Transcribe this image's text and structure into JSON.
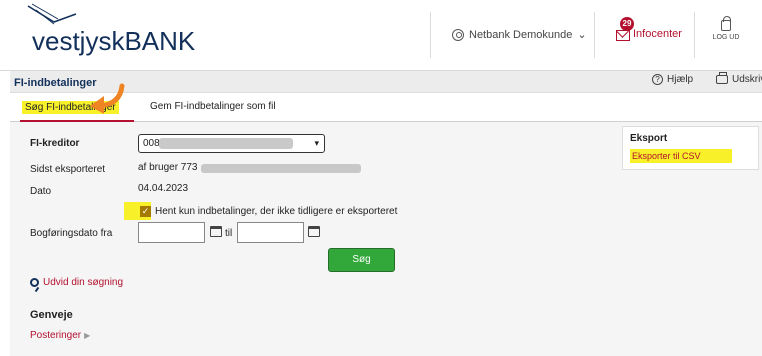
{
  "header": {
    "logo_text": "vestjyskBANK",
    "user_label": "Netbank Demokunde",
    "user_chevron": "⌄",
    "infocenter_label": "Infocenter",
    "infocenter_badge": "29",
    "logout_label": "LOG UD"
  },
  "titlebar": {
    "page_title": "FI-indbetalinger",
    "help_label": "Hjælp",
    "print_label": "Udskriv"
  },
  "tabs": [
    {
      "label": "Søg FI-indbetalinger",
      "active": true
    },
    {
      "label": "Gem FI-indbetalinger som fil",
      "active": false
    }
  ],
  "form": {
    "creditor_label": "FI-kreditor",
    "creditor_value": "0083",
    "exported_label": "Sidst eksporteret",
    "exported_value": "af bruger 773",
    "date_label": "Dato",
    "date_value": "04.04.2023",
    "checkbox_label": "Hent kun indbetalinger, der ikke tidligere er eksporteret",
    "checkbox_checked": true,
    "posting_date_label": "Bogføringsdato fra",
    "to_label": "til",
    "search_button": "Søg",
    "expand_search": "Udvid din søgning"
  },
  "shortcuts": {
    "title": "Genveje",
    "items": [
      "Posteringer"
    ]
  },
  "export": {
    "title": "Eksport",
    "link": "Eksporter til CSV"
  },
  "colors": {
    "brand_navy": "#13305a",
    "accent_red": "#b3112f",
    "highlight_yellow": "#f8f12a",
    "button_green": "#32a83a",
    "arrow_orange": "#ef8424"
  }
}
